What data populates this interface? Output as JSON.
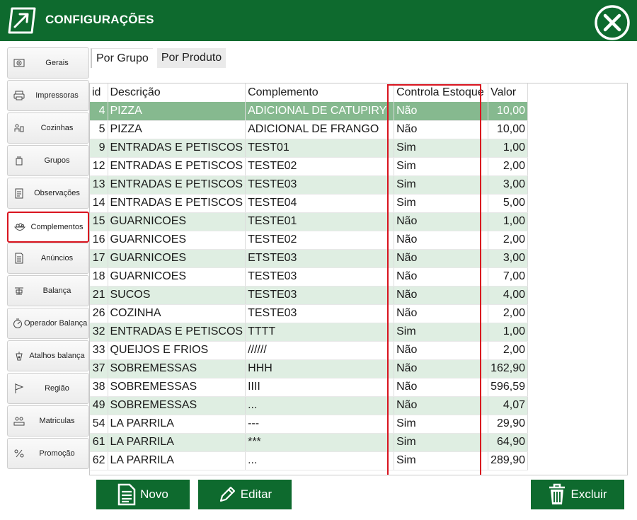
{
  "window": {
    "title": "CONFIGURAÇÕES"
  },
  "sidebar": {
    "items": [
      {
        "label": "Gerais",
        "icon": "settings-panel-icon"
      },
      {
        "label": "Impressoras",
        "icon": "printer-icon"
      },
      {
        "label": "Cozinhas",
        "icon": "kitchen-icon"
      },
      {
        "label": "Grupos",
        "icon": "group-icon"
      },
      {
        "label": "Observações",
        "icon": "clipboard-icon"
      },
      {
        "label": "Complementos",
        "icon": "bowl-icon",
        "active": true
      },
      {
        "label": "Anúncios",
        "icon": "document-icon"
      },
      {
        "label": "Balança",
        "icon": "scale-icon"
      },
      {
        "label": "Operador Balança",
        "icon": "scale-operator-icon"
      },
      {
        "label": "Atalhos balança",
        "icon": "scale-shortcut-icon"
      },
      {
        "label": "Região",
        "icon": "flag-icon"
      },
      {
        "label": "Matriculas",
        "icon": "registration-icon"
      },
      {
        "label": "Promoção",
        "icon": "promotion-icon"
      }
    ]
  },
  "tabs": [
    {
      "label": "Por Grupo",
      "selected": true
    },
    {
      "label": "Por Produto",
      "selected": false
    }
  ],
  "table": {
    "columns": [
      "id",
      "Descrição",
      "Complemento",
      "Controla Estoque",
      "Valor"
    ],
    "rows": [
      [
        "4",
        "PIZZA",
        "ADICIONAL DE CATUPIRY",
        "Não",
        "10,00"
      ],
      [
        "5",
        "PIZZA",
        "ADICIONAL DE FRANGO",
        "Não",
        "10,00"
      ],
      [
        "9",
        "ENTRADAS E PETISCOS",
        "TEST01",
        "Sim",
        "1,00"
      ],
      [
        "12",
        "ENTRADAS E PETISCOS",
        "TESTE02",
        "Sim",
        "2,00"
      ],
      [
        "13",
        "ENTRADAS E PETISCOS",
        "TESTE03",
        "Sim",
        "3,00"
      ],
      [
        "14",
        "ENTRADAS E PETISCOS",
        "TESTE04",
        "Sim",
        "5,00"
      ],
      [
        "15",
        "GUARNICOES",
        "TESTE01",
        "Não",
        "1,00"
      ],
      [
        "16",
        "GUARNICOES",
        "TESTE02",
        "Não",
        "2,00"
      ],
      [
        "17",
        "GUARNICOES",
        "ETSTE03",
        "Não",
        "3,00"
      ],
      [
        "18",
        "GUARNICOES",
        "TESTE03",
        "Não",
        "7,00"
      ],
      [
        "21",
        "SUCOS",
        "TESTE03",
        "Não",
        "4,00"
      ],
      [
        "26",
        "COZINHA",
        "TESTE03",
        "Não",
        "2,00"
      ],
      [
        "32",
        "ENTRADAS E PETISCOS",
        "TTTT",
        "Sim",
        "1,00"
      ],
      [
        "33",
        "QUEIJOS E FRIOS",
        "//////",
        "Não",
        "2,00"
      ],
      [
        "37",
        "SOBREMESSAS",
        "HHH",
        "Não",
        "162,90"
      ],
      [
        "38",
        "SOBREMESSAS",
        "IIII",
        "Não",
        "596,59"
      ],
      [
        "49",
        "SOBREMESSAS",
        "...",
        "Não",
        "4,07"
      ],
      [
        "54",
        "LA PARRILA",
        "---",
        "Sim",
        "29,90"
      ],
      [
        "61",
        "LA PARRILA",
        "***",
        "Sim",
        "64,90"
      ],
      [
        "62",
        "LA PARRILA",
        "...",
        "Sim",
        "289,90"
      ]
    ],
    "selected_row_index": 0
  },
  "buttons": {
    "new_label": "Novo",
    "edit_label": "Editar",
    "delete_label": "Excluir"
  },
  "colors": {
    "brand": "#0e6a2e",
    "row_alt": "#dfeee2",
    "row_selected": "#86b98f",
    "highlight": "#d9141f"
  }
}
